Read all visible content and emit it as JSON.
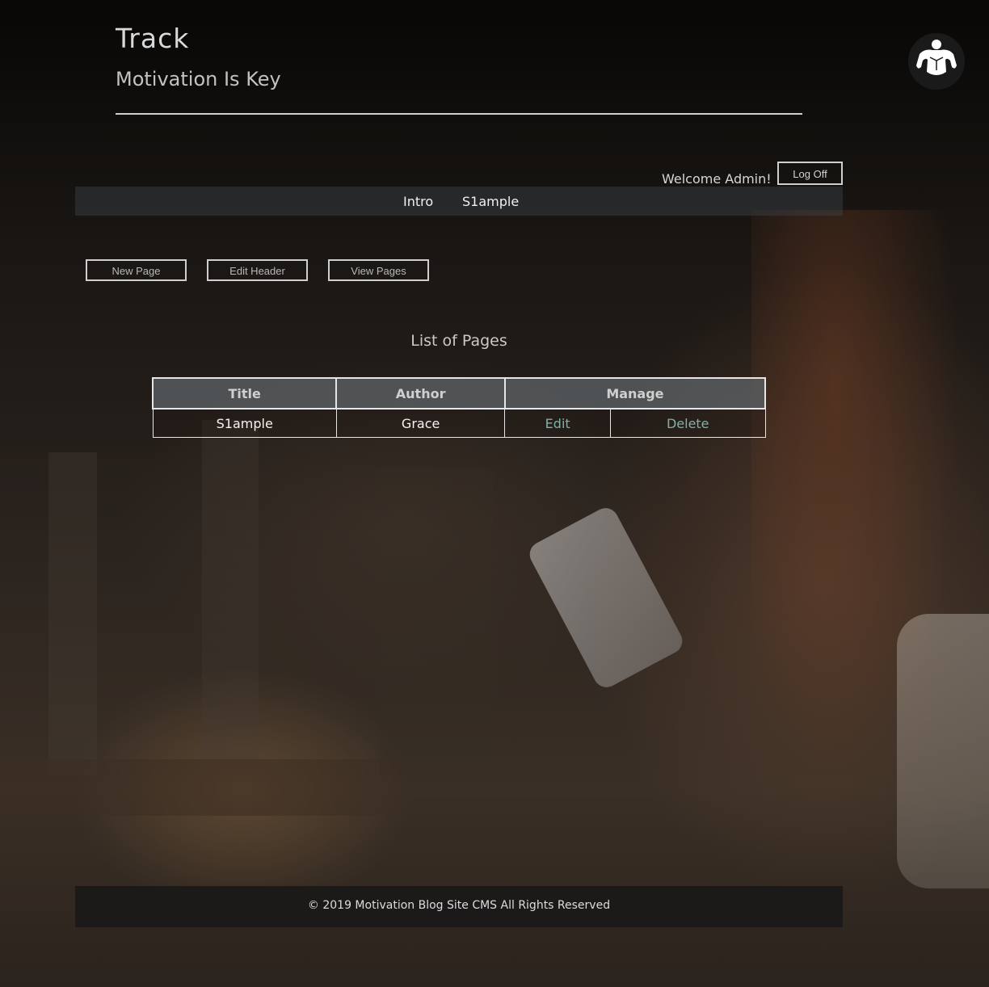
{
  "header": {
    "title": "Track",
    "subtitle": "Motivation Is Key",
    "logo_icon": "bodybuilder-icon"
  },
  "user": {
    "welcome": "Welcome Admin!",
    "logoff_label": "Log Off"
  },
  "nav": {
    "items": [
      {
        "label": "Intro"
      },
      {
        "label": "S1ample"
      }
    ]
  },
  "actions": {
    "new_page": "New Page",
    "edit_header": "Edit Header",
    "view_pages": "View Pages"
  },
  "pages_list": {
    "heading": "List of Pages",
    "columns": [
      "Title",
      "Author",
      "Manage"
    ],
    "rows": [
      {
        "title": "S1ample",
        "author": "Grace",
        "edit": "Edit",
        "delete": "Delete"
      }
    ]
  },
  "footer": {
    "text": "© 2019 Motivation Blog Site CMS All Rights Reserved"
  },
  "colors": {
    "link": "#7fb0ad",
    "border": "#cfcfcf"
  }
}
